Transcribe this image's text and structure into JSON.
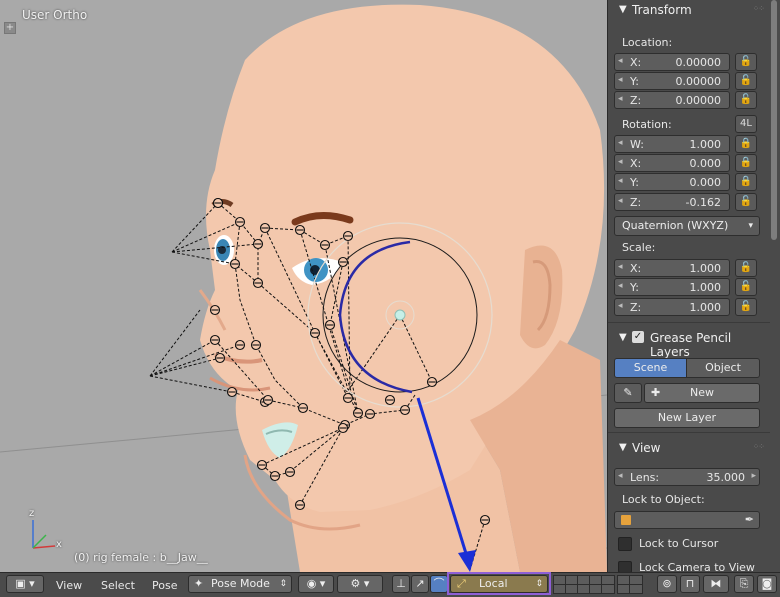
{
  "viewport": {
    "view_name": "User Ortho",
    "plus_tab": "+",
    "status_text": "(0) rig female : b__Jaw__",
    "axes": {
      "x": "x",
      "z": "z"
    }
  },
  "panel": {
    "transform": {
      "header": "Transform",
      "location_label": "Location:",
      "location": [
        {
          "axis": "X:",
          "value": "0.00000"
        },
        {
          "axis": "Y:",
          "value": "0.00000"
        },
        {
          "axis": "Z:",
          "value": "0.00000"
        }
      ],
      "rotation_label": "Rotation:",
      "rotation_mode_button": "4L",
      "rotation": [
        {
          "axis": "W:",
          "value": "1.000"
        },
        {
          "axis": "X:",
          "value": "0.000"
        },
        {
          "axis": "Y:",
          "value": "0.000"
        },
        {
          "axis": "Z:",
          "value": "-0.162"
        }
      ],
      "rotation_mode": "Quaternion (WXYZ)",
      "scale_label": "Scale:",
      "scale": [
        {
          "axis": "X:",
          "value": "1.000"
        },
        {
          "axis": "Y:",
          "value": "1.000"
        },
        {
          "axis": "Z:",
          "value": "1.000"
        }
      ]
    },
    "grease_pencil": {
      "header": "Grease Pencil Layers",
      "tab_scene": "Scene",
      "tab_object": "Object",
      "new_button": "New",
      "new_layer_button": "New Layer"
    },
    "view": {
      "header": "View",
      "lens_label": "Lens:",
      "lens_value": "35.000",
      "lock_to_object_label": "Lock to Object:",
      "lock_to_cursor_label": "Lock to Cursor",
      "lock_camera_label": "Lock Camera to View"
    }
  },
  "toolbar": {
    "menu_view": "View",
    "menu_select": "Select",
    "menu_pose": "Pose",
    "mode": "Pose Mode",
    "orientation": "Local"
  },
  "colors": {
    "viewport_bg": "#a9a9a9",
    "panel_bg": "#4a4a4a",
    "active_tab": "#5680c2",
    "highlight_box": "#8e5fd6",
    "arrow": "#1b2fd6"
  }
}
